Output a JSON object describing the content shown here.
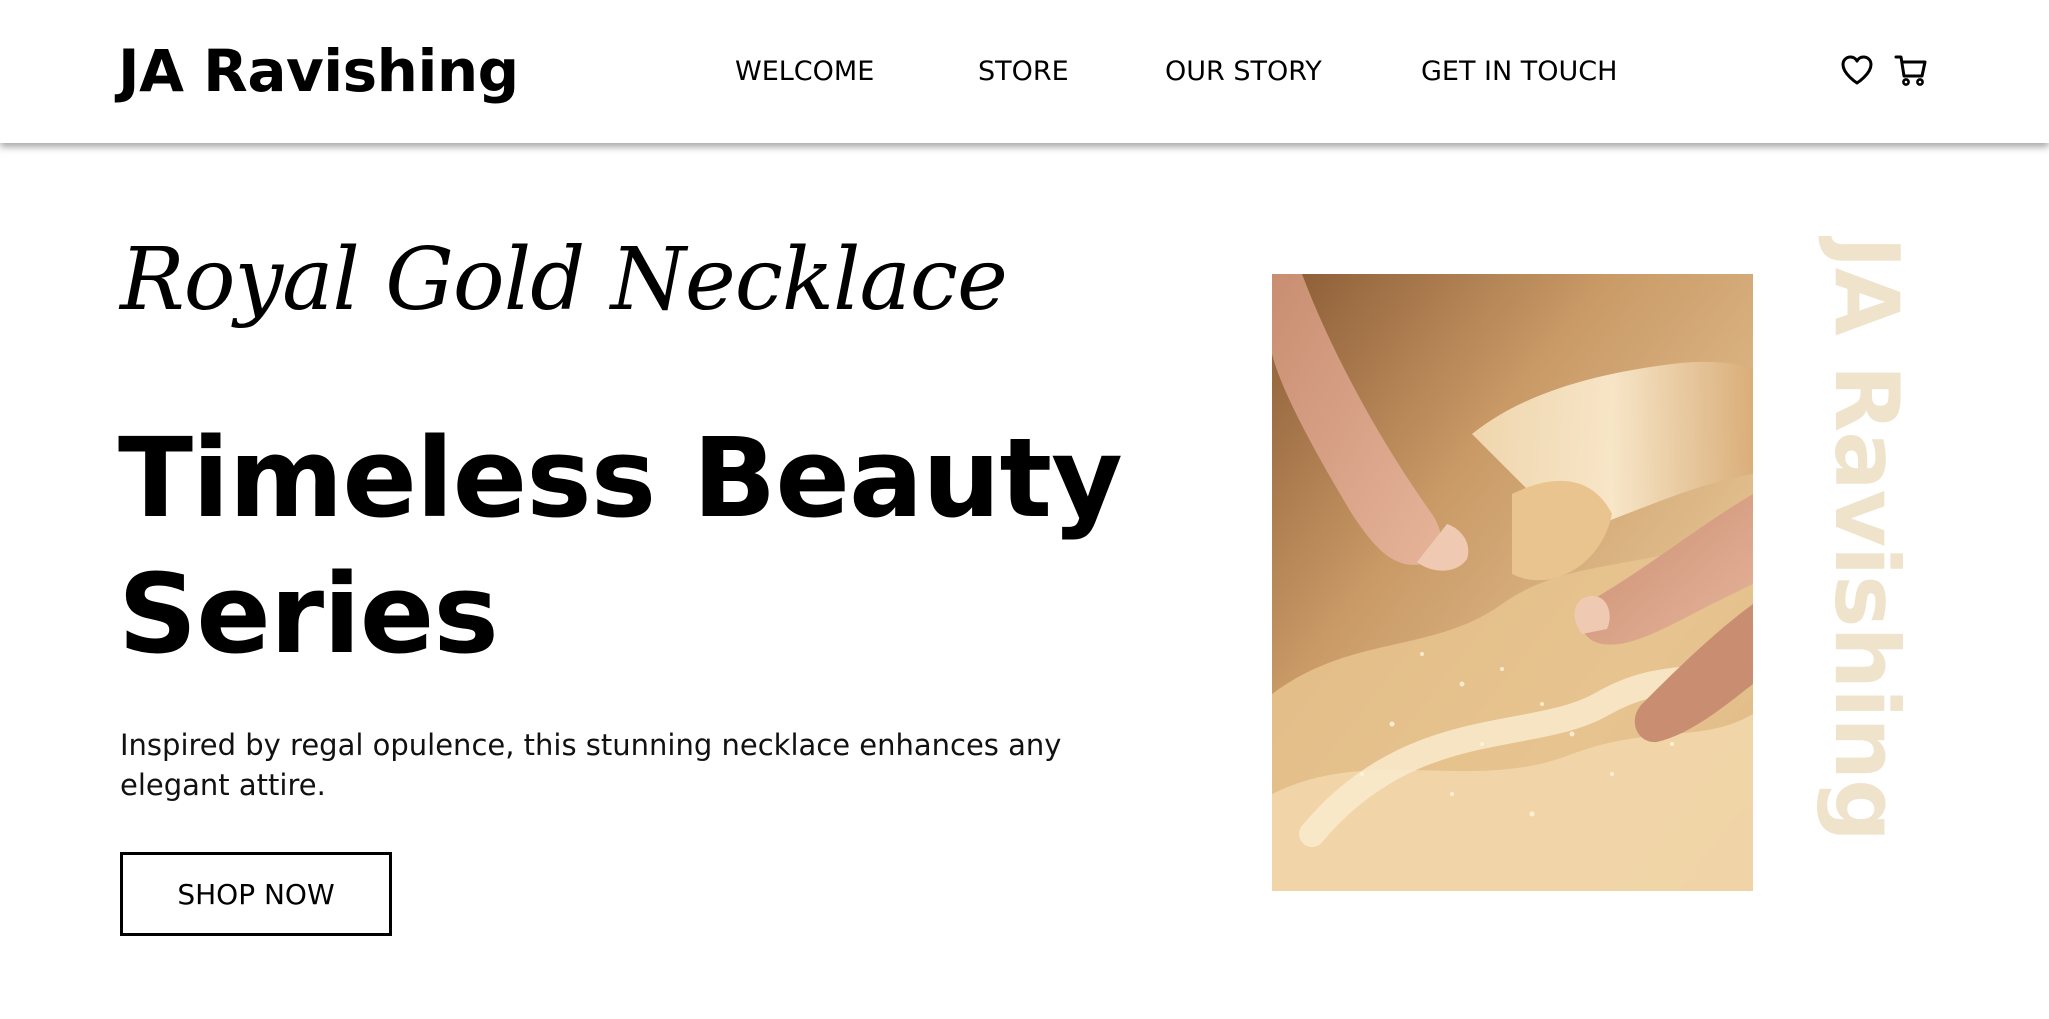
{
  "header": {
    "brand": "JA Ravishing",
    "nav": {
      "welcome": "WELCOME",
      "store": "STORE",
      "our_story": "OUR STORY",
      "get_in_touch": "GET IN TOUCH"
    },
    "icons": {
      "wishlist": "heart-icon",
      "cart": "cart-icon"
    }
  },
  "hero": {
    "script_title": "Royal Gold Necklace",
    "headline_line1": "Timeless Beauty",
    "headline_line2": "Series",
    "description": "Inspired by regal opulence, this stunning necklace enhances any elegant attire.",
    "cta_label": "SHOP NOW",
    "vertical_brand": "JA Ravishing"
  },
  "colors": {
    "text": "#000000",
    "background": "#ffffff",
    "watermark": "#efe3cc",
    "image_gold": "#c9955e"
  }
}
